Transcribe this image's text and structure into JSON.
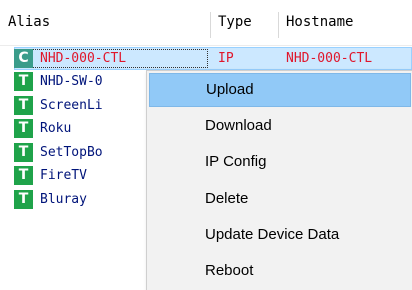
{
  "columns": {
    "alias": "Alias",
    "type": "Type",
    "hostname": "Hostname"
  },
  "rows": [
    {
      "badge": "C",
      "alias": "NHD-000-CTL",
      "type": "IP",
      "hostname": "NHD-000-CTL",
      "selected": true
    },
    {
      "badge": "T",
      "alias": "NHD-SW-0",
      "type": "",
      "hostname": ""
    },
    {
      "badge": "T",
      "alias": "ScreenLi",
      "type": "",
      "hostname": ""
    },
    {
      "badge": "T",
      "alias": "Roku",
      "type": "",
      "hostname": ""
    },
    {
      "badge": "T",
      "alias": "SetTopBo",
      "type": "",
      "hostname": ""
    },
    {
      "badge": "T",
      "alias": "FireTV",
      "type": "",
      "hostname": ""
    },
    {
      "badge": "T",
      "alias": "Bluray",
      "type": "",
      "hostname": ""
    }
  ],
  "context_menu": {
    "items": [
      "Upload",
      "Download",
      "IP Config",
      "Delete",
      "Update Device Data",
      "Reboot"
    ],
    "highlighted": "Upload"
  },
  "colors": {
    "selected_row_bg": "#cce8ff",
    "menu_highlight": "#91c9f7",
    "badge_t": "#1fa34a",
    "alias_text": "#00147a",
    "selected_text": "#e0162b"
  }
}
